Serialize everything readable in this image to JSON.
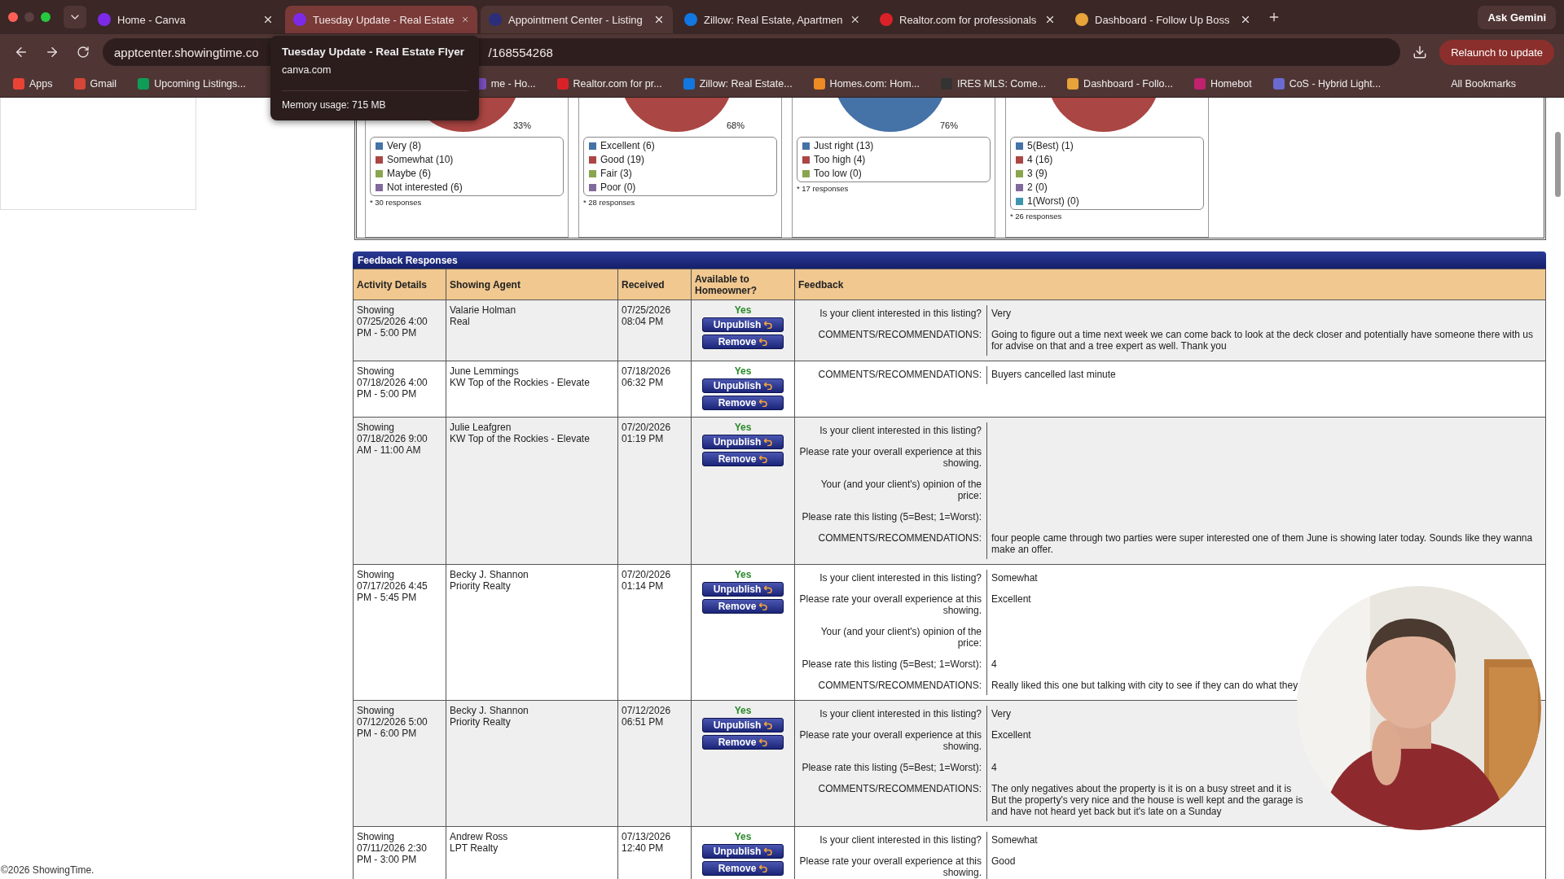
{
  "browser": {
    "tabs": [
      {
        "title": "Home - Canva",
        "selected": false,
        "hovered": false
      },
      {
        "title": "Tuesday Update - Real Estate",
        "selected": false,
        "hovered": true
      },
      {
        "title": "Appointment Center - Listing",
        "selected": true,
        "hovered": false
      },
      {
        "title": "Zillow: Real Estate, Apartmen",
        "selected": false,
        "hovered": false
      },
      {
        "title": "Realtor.com for professionals",
        "selected": false,
        "hovered": false
      },
      {
        "title": "Dashboard - Follow Up Boss",
        "selected": false,
        "hovered": false
      }
    ],
    "ask_gemini": "Ask Gemini",
    "address": {
      "host": "apptcenter.showingtime.co",
      "path": "/168554268"
    },
    "relaunch": "Relaunch to update",
    "bookmarks": [
      "Apps",
      "Gmail",
      "Upcoming Listings..."
    ],
    "bookmarks_after_tooltip": [
      "me - Ho...",
      "Realtor.com for pr...",
      "Zillow: Real Estate...",
      "Homes.com: Hom...",
      "IRES MLS: Come...",
      "Dashboard - Follo...",
      "Homebot",
      "CoS - Hybrid Light..."
    ],
    "all_bookmarks": "All Bookmarks",
    "tab_tooltip": {
      "title": "Tuesday Update - Real Estate Flyer",
      "site": "canva.com",
      "memory": "Memory usage: 715 MB"
    }
  },
  "charts": [
    {
      "color": "#aa4643",
      "percent": "33%",
      "legend": [
        {
          "label": "Very (8)",
          "color": "#4572a7"
        },
        {
          "label": "Somewhat (10)",
          "color": "#aa4643"
        },
        {
          "label": "Maybe (6)",
          "color": "#89a54e"
        },
        {
          "label": "Not interested (6)",
          "color": "#80699b"
        }
      ],
      "note": "* 30 responses"
    },
    {
      "color": "#aa4643",
      "percent": "68%",
      "legend": [
        {
          "label": "Excellent (6)",
          "color": "#4572a7"
        },
        {
          "label": "Good (19)",
          "color": "#aa4643"
        },
        {
          "label": "Fair (3)",
          "color": "#89a54e"
        },
        {
          "label": "Poor (0)",
          "color": "#80699b"
        }
      ],
      "note": "* 28 responses"
    },
    {
      "color": "#4572a7",
      "percent": "76%",
      "legend": [
        {
          "label": "Just right (13)",
          "color": "#4572a7"
        },
        {
          "label": "Too high (4)",
          "color": "#aa4643"
        },
        {
          "label": "Too low (0)",
          "color": "#89a54e"
        }
      ],
      "note": "* 17 responses"
    },
    {
      "color": "#aa4643",
      "legend": [
        {
          "label": "5(Best) (1)",
          "color": "#4572a7"
        },
        {
          "label": "4 (16)",
          "color": "#aa4643"
        },
        {
          "label": "3 (9)",
          "color": "#89a54e"
        },
        {
          "label": "2 (0)",
          "color": "#80699b"
        },
        {
          "label": "1(Worst) (0)",
          "color": "#3d96ae"
        }
      ],
      "note": "* 26 responses"
    }
  ],
  "feedback": {
    "title": "Feedback Responses",
    "columns": [
      "Activity Details",
      "Showing Agent",
      "Received",
      "Available to Homeowner?",
      "Feedback"
    ],
    "rows": [
      {
        "activity": "Showing 07/25/2026 4:00 PM - 5:00 PM",
        "agent": "Valarie Holman",
        "office": "Real",
        "received": "07/25/2026 08:04 PM",
        "available": "Yes",
        "actions": [
          "Unpublish",
          "Remove"
        ],
        "items": [
          {
            "question": "Is your client interested in this listing?",
            "answer": "Very"
          },
          {
            "question": "COMMENTS/RECOMMENDATIONS:",
            "answer": "Going to figure out a time next week we can come back to look at the deck closer and potentially have someone there with us for advise on that and a tree expert as well. Thank you"
          }
        ]
      },
      {
        "activity": "Showing 07/18/2026 4:00 PM - 5:00 PM",
        "agent": "June Lemmings",
        "office": "KW Top of the Rockies - Elevate",
        "received": "07/18/2026 06:32 PM",
        "available": "Yes",
        "actions": [
          "Unpublish",
          "Remove"
        ],
        "items": [
          {
            "question": "COMMENTS/RECOMMENDATIONS:",
            "answer": "Buyers cancelled last minute"
          }
        ]
      },
      {
        "activity": "Showing 07/18/2026 9:00 AM - 11:00 AM",
        "agent": "Julie Leafgren",
        "office": "KW Top of the Rockies - Elevate",
        "received": "07/20/2026 01:19 PM",
        "available": "Yes",
        "actions": [
          "Unpublish",
          "Remove"
        ],
        "items": [
          {
            "question": "Is your client interested in this listing?"
          },
          {
            "question": "Please rate your overall experience at this showing."
          },
          {
            "question": "Your (and your client's) opinion of the price:"
          },
          {
            "question": "Please rate this listing (5=Best; 1=Worst):"
          },
          {
            "question": "COMMENTS/RECOMMENDATIONS:",
            "answer": "four people came through two parties were super interested one of them June is showing later today. Sounds like they wanna make an offer."
          }
        ]
      },
      {
        "activity": "Showing 07/17/2026 4:45 PM - 5:45 PM",
        "agent": "Becky J. Shannon",
        "office": "Priority Realty",
        "received": "07/20/2026 01:14 PM",
        "available": "Yes",
        "actions": [
          "Unpublish",
          "Remove"
        ],
        "items": [
          {
            "question": "Is your client interested in this listing?",
            "answer": "Somewhat"
          },
          {
            "question": "Please rate your overall experience at this showing.",
            "answer": "Excellent"
          },
          {
            "question": "Your (and your client's) opinion of the price:"
          },
          {
            "question": "Please rate this listing (5=Best; 1=Worst):",
            "answer": "4"
          },
          {
            "question": "COMMENTS/RECOMMENDATIONS:",
            "lines": [
              "Really liked this one but talking with city to see if they can do what they"
            ]
          }
        ]
      },
      {
        "activity": "Showing 07/12/2026 5:00 PM - 6:00 PM",
        "agent": "Becky J. Shannon",
        "office": "Priority Realty",
        "received": "07/12/2026 06:51 PM",
        "available": "Yes",
        "actions": [
          "Unpublish",
          "Remove"
        ],
        "items": [
          {
            "question": "Is your client interested in this listing?",
            "answer": "Very"
          },
          {
            "question": "Please rate your overall experience at this showing.",
            "answer": "Excellent"
          },
          {
            "question": "Please rate this listing (5=Best; 1=Worst):",
            "answer": "4"
          },
          {
            "question": "COMMENTS/RECOMMENDATIONS:",
            "lines": [
              "The only negatives about the property is it is on a busy street and it is",
              "But the property's very nice and the house is well kept and the garage is",
              "and have not heard yet back but it's late on a Sunday"
            ]
          }
        ]
      },
      {
        "activity": "Showing 07/11/2026 2:30 PM - 3:00 PM",
        "agent": "Andrew Ross",
        "office": "LPT Realty",
        "received": "07/13/2026 12:40 PM",
        "available": "Yes",
        "actions": [
          "Unpublish",
          "Remove"
        ],
        "items": [
          {
            "question": "Is your client interested in this listing?",
            "answer": "Somewhat"
          },
          {
            "question": "Please rate your overall experience at this showing.",
            "answer": "Good"
          }
        ]
      }
    ]
  },
  "footer": "©2026 ShowingTime."
}
